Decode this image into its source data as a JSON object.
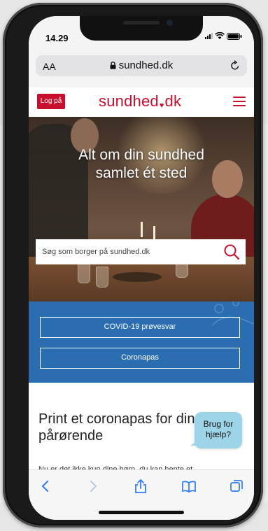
{
  "status_bar": {
    "time": "14.29"
  },
  "browser": {
    "text_size_label": "AA",
    "url": "sundhed.dk"
  },
  "site": {
    "login_label": "Log på",
    "logo_text_left": "sundhed",
    "logo_text_right": "dk",
    "hero_title_line1": "Alt om din sundhed",
    "hero_title_line2": "samlet ét sted",
    "search_placeholder": "Søg som borger på sundhed.dk",
    "button_covid_test": "COVID-19 prøvesvar",
    "button_coronapas": "Coronapas",
    "section_heading": "Print et coronapas for dine pårørende",
    "section_paragraph": "Nu er det ikke kun dine børn, du kan hente et",
    "help_label_line1": "Brug for",
    "help_label_line2": "hjælp?"
  },
  "colors": {
    "brand_red": "#c8102e",
    "band_blue": "#2a6db0",
    "help_bubble": "#9ed4e8"
  },
  "icons": {
    "status": [
      "signal-icon",
      "wifi-icon",
      "battery-icon"
    ],
    "browser": [
      "lock-icon",
      "reload-icon"
    ],
    "site": [
      "hamburger-menu-icon",
      "search-icon"
    ],
    "toolbar": [
      "back-icon",
      "forward-icon",
      "share-icon",
      "bookmarks-icon",
      "tabs-icon"
    ]
  }
}
